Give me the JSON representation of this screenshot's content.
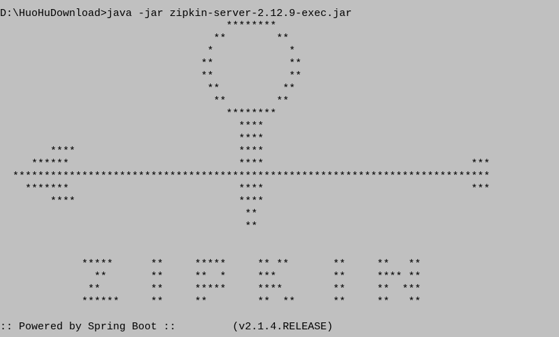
{
  "terminal": {
    "command_line": "D:\\HuoHuDownload>java -jar zipkin-server-2.12.9-exec.jar",
    "banner": [
      "                                    ********",
      "                                  **        **",
      "                                 *            *",
      "                                **            **",
      "                                **            **",
      "                                 **          **",
      "                                  **        **",
      "                                    ********",
      "                                      ****",
      "                                      ****",
      "        ****                          ****",
      "     ******                           ****                                 ***",
      "  ****************************************************************************",
      "    *******                           ****                                 ***",
      "        ****                          ****",
      "                                       **",
      "                                       **",
      "",
      "",
      "             *****      **     *****     ** **       **     **   **",
      "               **       **     **  *     ***         **     **** **",
      "              **        **     *****     ****        **     **  ***",
      "             ******     **     **        **  **      **     **   **"
    ],
    "footer_line": ":: Powered by Spring Boot ::         (v2.1.4.RELEASE)"
  }
}
